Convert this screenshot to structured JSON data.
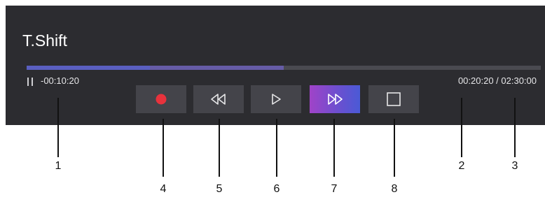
{
  "header": {
    "title": "T.Shift"
  },
  "playback": {
    "shift_time": "-00:10:20",
    "time_info": "00:20:20 / 02:30:00",
    "watched_fraction": 0.24,
    "buffered_fraction": 0.5
  },
  "controls": [
    {
      "name": "record-button",
      "icon": "record-icon"
    },
    {
      "name": "rewind-button",
      "icon": "rewind-icon"
    },
    {
      "name": "play-button",
      "icon": "play-icon"
    },
    {
      "name": "fast-forward-button",
      "icon": "fast-forward-icon",
      "active": true
    },
    {
      "name": "stop-button",
      "icon": "stop-icon"
    }
  ],
  "colors": {
    "panel": "#2c2c30",
    "button": "#44444a",
    "record": "#e8323c",
    "progress_watched": "#5a5fc0",
    "active_gradient": [
      "#a043c8",
      "#4a5ad6"
    ]
  },
  "callouts": [
    "1",
    "2",
    "3",
    "4",
    "5",
    "6",
    "7",
    "8"
  ]
}
